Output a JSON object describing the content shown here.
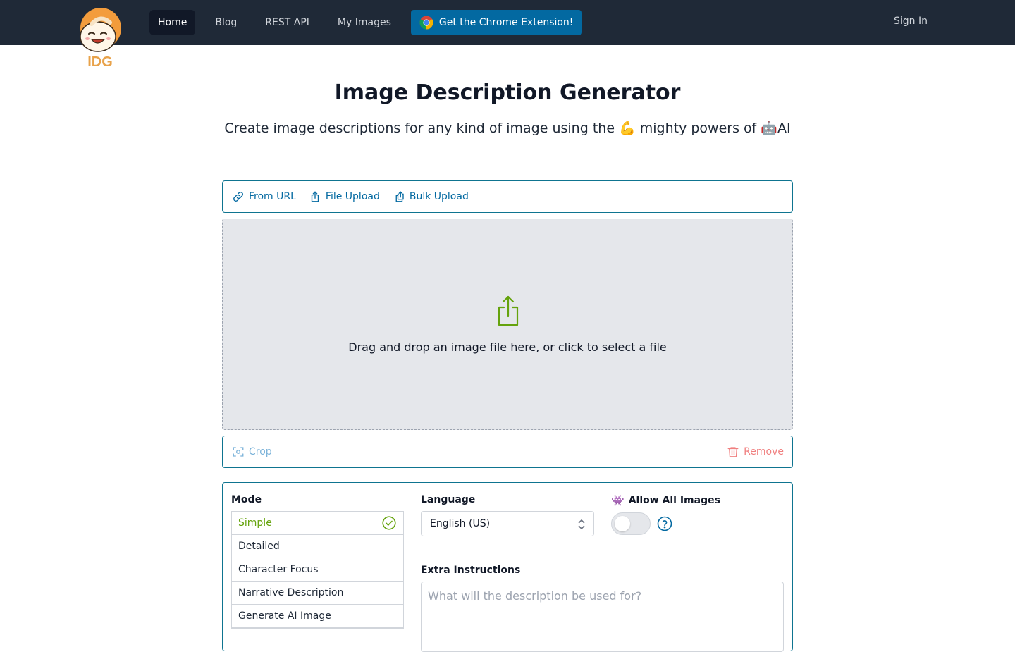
{
  "header": {
    "logo_text": "IDG",
    "nav": [
      {
        "label": "Home",
        "active": true
      },
      {
        "label": "Blog",
        "active": false
      },
      {
        "label": "REST API",
        "active": false
      },
      {
        "label": "My Images",
        "active": false
      }
    ],
    "chrome_button": {
      "label": "Get the Chrome Extension!",
      "icon": "chrome-icon"
    },
    "sign_in": "Sign In"
  },
  "hero": {
    "title": "Image Description Generator",
    "subtitle": "Create image descriptions for any kind of image using the 💪 mighty powers of 🤖AI"
  },
  "upload_tabs": [
    {
      "label": "From URL",
      "icon": "link-icon"
    },
    {
      "label": "File Upload",
      "icon": "upload-icon"
    },
    {
      "label": "Bulk Upload",
      "icon": "bulk-upload-icon"
    }
  ],
  "dropzone": {
    "text": "Drag and drop an image file here, or click to select a file",
    "icon": "share-upload-icon"
  },
  "image_toolbar": {
    "crop": "Crop",
    "remove": "Remove"
  },
  "options": {
    "mode_label": "Mode",
    "modes": [
      {
        "label": "Simple",
        "selected": true
      },
      {
        "label": "Detailed",
        "selected": false
      },
      {
        "label": "Character Focus",
        "selected": false
      },
      {
        "label": "Narrative Description",
        "selected": false
      },
      {
        "label": "Generate AI Image",
        "selected": false
      }
    ],
    "language_label": "Language",
    "language_value": "English (US)",
    "allow_label": "Allow All Images",
    "allow_emoji": "👾",
    "allow_enabled": false,
    "extra_label": "Extra Instructions",
    "extra_placeholder": "What will the description be used for?"
  },
  "colors": {
    "topbar": "#1f2937",
    "accent": "#0369a1",
    "success": "#65a30d",
    "danger": "#f08080"
  }
}
